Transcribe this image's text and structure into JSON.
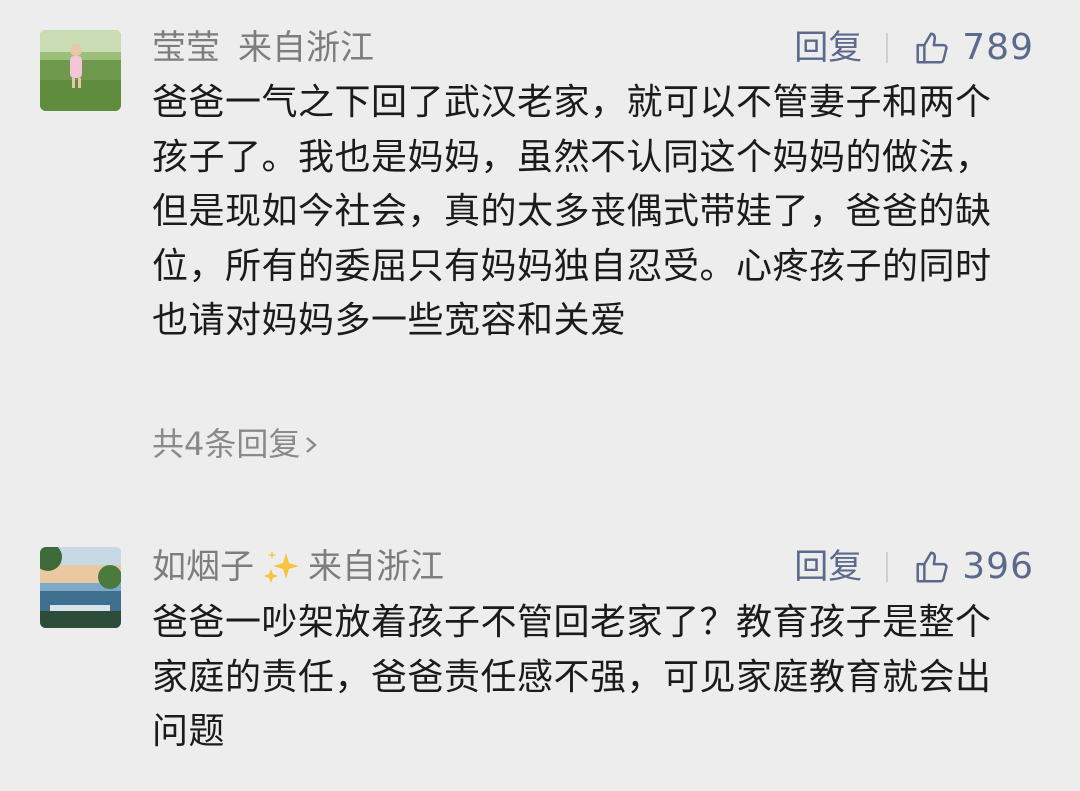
{
  "comments": [
    {
      "username": "莹莹",
      "location": "来自浙江",
      "reply_label": "回复",
      "like_count": "789",
      "text": "爸爸一气之下回了武汉老家，就可以不管妻子和两个孩子了。我也是妈妈，虽然不认同这个妈妈的做法，但是现如今社会，真的太多丧偶式带娃了，爸爸的缺位，所有的委屈只有妈妈独自忍受。心疼孩子的同时也请对妈妈多一些宽容和关爱",
      "replies_link": "共4条回复"
    },
    {
      "username": "如烟子",
      "location": "来自浙江",
      "reply_label": "回复",
      "like_count": "396",
      "text": "爸爸一吵架放着孩子不管回老家了？教育孩子是整个家庭的责任，爸爸责任感不强，可见家庭教育就会出问题"
    }
  ],
  "colors": {
    "background": "#ededed",
    "action_blue": "#5b6a8c",
    "meta_gray": "#7d7d7d",
    "body_text": "#1b1b1b",
    "sparkle_yellow": "#f5c542"
  },
  "icons": [
    "thumbs-up-icon",
    "sparkle-icon",
    "chevron-right-icon"
  ]
}
